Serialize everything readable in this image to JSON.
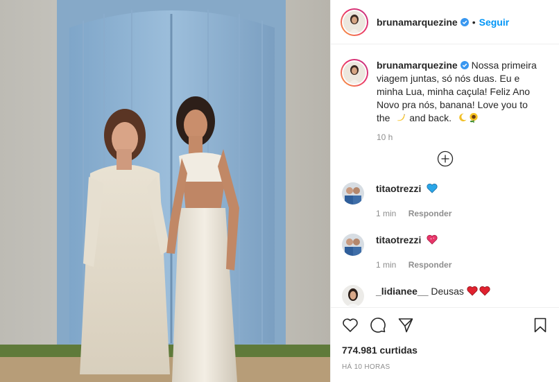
{
  "post": {
    "username": "brunamarquezine",
    "follow_label": "Seguir",
    "dot": "•",
    "caption_lines": [
      "Nossa primeira",
      "viagem juntas, só nós duas. Eu e",
      "minha Lua, minha caçula! Feliz Ano",
      "Novo pra nós, banana! Love you to",
      "the",
      "and back."
    ],
    "caption_time": "10 h"
  },
  "comments": [
    {
      "username": "titaotrezzi",
      "emoji": "blue-heart",
      "time": "1 min",
      "reply_label": "Responder"
    },
    {
      "username": "titaotrezzi",
      "emoji": "sparkling-heart",
      "time": "1 min",
      "reply_label": "Responder"
    },
    {
      "username": "_lidianee__",
      "text": "Deusas",
      "emoji": "red-heart-x2"
    }
  ],
  "footer": {
    "likes": "774.981 curtidas",
    "ago": "HÁ 10 HORAS"
  },
  "colors": {
    "accent": "#0095f6",
    "verified": "#3897f0",
    "muted": "#8e8e8e",
    "text": "#262626",
    "door_blue": "#8fb3d3"
  }
}
